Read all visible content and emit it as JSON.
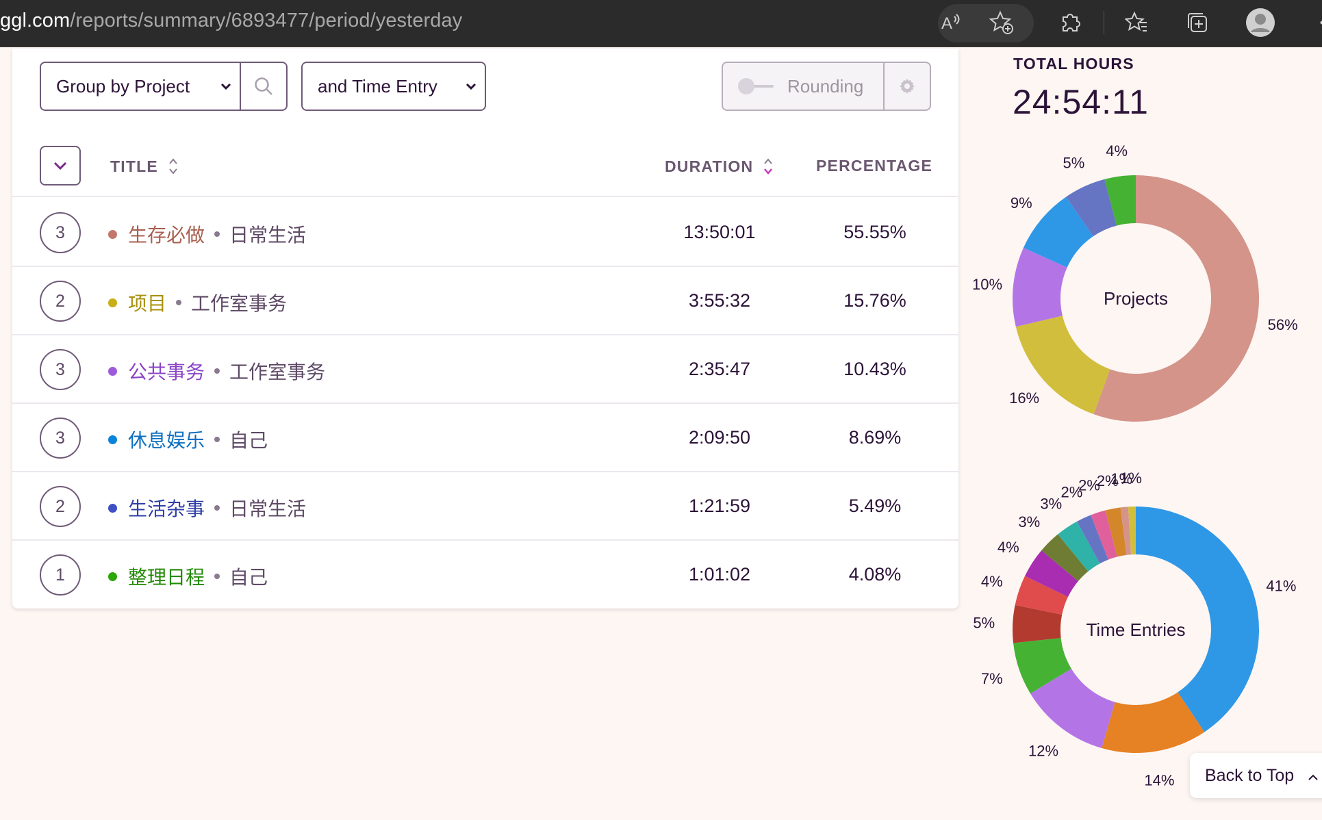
{
  "browser": {
    "url_host": "ggl.com",
    "url_path": "/reports/summary/6893477/period/yesterday"
  },
  "toolbar": {
    "group_by": "Group by Project",
    "sub_group": "and Time Entry",
    "rounding": "Rounding"
  },
  "table": {
    "headers": {
      "title": "TITLE",
      "duration": "DURATION",
      "percentage": "PERCENTAGE"
    },
    "rows": [
      {
        "count": "3",
        "project": "生存必做",
        "client": "日常生活",
        "duration": "13:50:01",
        "percentage": "55.55%",
        "color": "#c3776a"
      },
      {
        "count": "2",
        "project": "项目",
        "client": "工作室事务",
        "duration": "3:55:32",
        "percentage": "15.76%",
        "color": "#c8ae17"
      },
      {
        "count": "3",
        "project": "公共事务",
        "client": "工作室事务",
        "duration": "2:35:47",
        "percentage": "10.43%",
        "color": "#9e5bd9"
      },
      {
        "count": "3",
        "project": "休息娱乐",
        "client": "自己",
        "duration": "2:09:50",
        "percentage": "8.69%",
        "color": "#0b83d9"
      },
      {
        "count": "2",
        "project": "生活杂事",
        "client": "日常生活",
        "duration": "1:21:59",
        "percentage": "5.49%",
        "color": "#3e50c3"
      },
      {
        "count": "1",
        "project": "整理日程",
        "client": "自己",
        "duration": "1:01:02",
        "percentage": "4.08%",
        "color": "#2da608"
      }
    ],
    "project_text_colors": [
      "#a8604f",
      "#a8900a",
      "#8a45c6",
      "#0b6fbf",
      "#2f3fa6",
      "#238a04"
    ]
  },
  "summary": {
    "total_label": "TOTAL HOURS",
    "total_value": "24:54:11"
  },
  "chart_data": [
    {
      "type": "pie",
      "title": "Projects",
      "labels": [
        "56%",
        "16%",
        "10%",
        "9%",
        "5%",
        "4%"
      ],
      "values": [
        55.55,
        15.76,
        10.43,
        8.69,
        5.49,
        4.08
      ],
      "colors": [
        "#d4948a",
        "#d1be3c",
        "#b375e6",
        "#2f98e6",
        "#6674c4",
        "#45b233"
      ]
    },
    {
      "type": "pie",
      "title": "Time Entries",
      "labels": [
        "41%",
        "14%",
        "12%",
        "7%",
        "5%",
        "4%",
        "4%",
        "3%",
        "3%",
        "2%",
        "2%",
        "2%",
        "1%",
        "1%"
      ],
      "values": [
        41,
        14,
        12,
        7,
        5,
        4,
        4,
        3,
        3,
        2,
        2,
        2,
        1,
        1
      ],
      "colors": [
        "#2f98e6",
        "#e68124",
        "#b375e6",
        "#45b233",
        "#b23a2e",
        "#e04c4c",
        "#a82db0",
        "#6e7d33",
        "#2fb3a8",
        "#6674c4",
        "#e0609c",
        "#d4862a",
        "#d4948a",
        "#d1be3c"
      ]
    }
  ],
  "footer": {
    "back_to_top": "Back to Top"
  }
}
